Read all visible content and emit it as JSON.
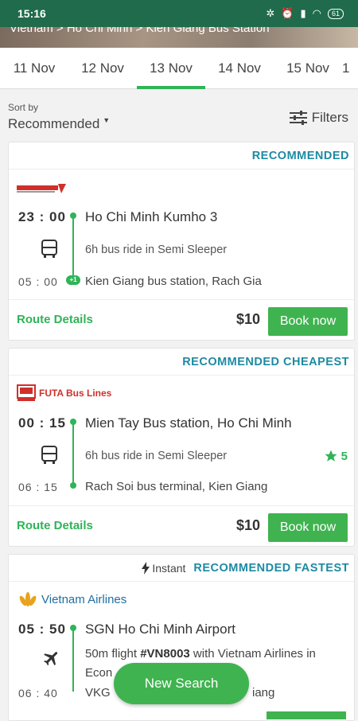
{
  "status": {
    "time": "15:16",
    "battery": "61"
  },
  "breadcrumb": "Vietnam > Ho Chi Minh > Kien Giang Bus Station",
  "dates": [
    "11 Nov",
    "12 Nov",
    "13 Nov",
    "14 Nov",
    "15 Nov",
    "1"
  ],
  "active_date": "13 Nov",
  "sort": {
    "label": "Sort by",
    "value": "Recommended",
    "filters_label": "Filters"
  },
  "results": [
    {
      "tag": "RECOMMENDED",
      "operator_logo": "bus operator logo",
      "depart_time": "23 : 00",
      "depart_place": "Ho Chi Minh Kumho 3",
      "vehicle_icon": "bus-icon",
      "duration": "6h bus ride in Semi Sleeper",
      "arrive_time": "05 : 00",
      "next_day": "+1",
      "arrive_place": "Kien Giang bus station, Rach Gia",
      "route_label": "Route Details",
      "price": "$10",
      "book_label": "Book now"
    },
    {
      "tag": "RECOMMENDED CHEAPEST",
      "operator_name": "FUTA Bus Lines",
      "depart_time": "00 : 15",
      "depart_place": "Mien Tay Bus station, Ho Chi Minh",
      "vehicle_icon": "bus-icon",
      "duration": "6h bus ride in Semi Sleeper",
      "rating": "5",
      "arrive_time": "06 : 15",
      "arrive_place": "Rach Soi bus terminal, Kien Giang",
      "route_label": "Route Details",
      "price": "$10",
      "book_label": "Book now"
    },
    {
      "instant_label": "Instant",
      "tag": "RECOMMENDED FASTEST",
      "operator_name": "Vietnam Airlines",
      "depart_time": "05 : 50",
      "depart_place": "SGN Ho Chi Minh Airport",
      "vehicle_icon": "plane-icon",
      "flight_line1_pre": "50m flight ",
      "flight_code": "#VN8003",
      "flight_line1_post": " with Vietnam Airlines in",
      "flight_line2": "Econ",
      "arrive_time": "06 : 40",
      "arrive_place": "VKG",
      "arrive_place_end": "iang"
    }
  ],
  "fab_label": "New Search",
  "colors": {
    "header": "#1f6b4b",
    "accent": "#3fb34f",
    "tag": "#1d8aa3"
  }
}
